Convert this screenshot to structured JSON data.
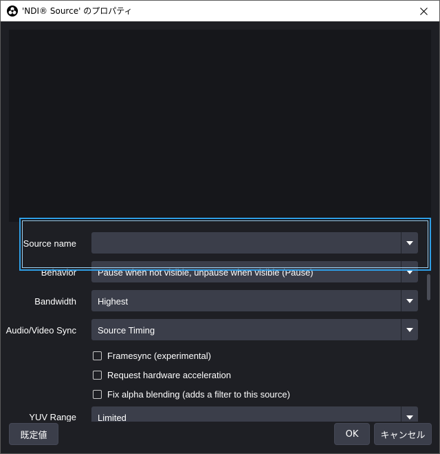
{
  "window": {
    "title": "'NDI® Source' のプロパティ"
  },
  "properties": {
    "source_name": {
      "label": "Source name",
      "value": ""
    },
    "behavior": {
      "label": "Behavior",
      "value": "Pause when not visible, unpause when visible (Pause)"
    },
    "bandwidth": {
      "label": "Bandwidth",
      "value": "Highest"
    },
    "av_sync": {
      "label": "Audio/Video Sync",
      "value": "Source Timing"
    },
    "checkboxes": [
      {
        "label": "Framesync (experimental)",
        "checked": false
      },
      {
        "label": "Request hardware acceleration",
        "checked": false
      },
      {
        "label": "Fix alpha blending (adds a filter to this source)",
        "checked": false
      }
    ],
    "yuv_range": {
      "label": "YUV Range",
      "value": "Limited"
    }
  },
  "buttons": {
    "defaults": "既定値",
    "ok": "OK",
    "cancel": "キャンセル"
  },
  "colors": {
    "accent_focus": "#2e9ee6",
    "background": "#1e1f24",
    "control": "#3b3e4a"
  },
  "icons": {
    "app": "obs-logo-icon",
    "close": "close-icon",
    "dropdown": "triangle-down-icon"
  }
}
